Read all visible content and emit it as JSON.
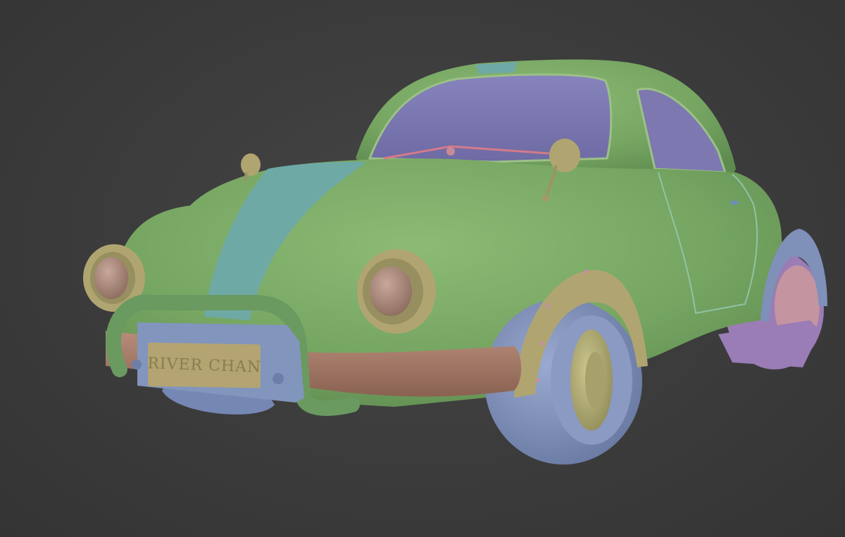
{
  "scene": {
    "subject": "stylized-car-model",
    "plate_text": "RIVER CHAN"
  },
  "colors": {
    "background": "#3b3b3b",
    "body_green": "#7ba866",
    "body_green_dark": "#5d8a4f",
    "stripe_teal": "#6ea9a6",
    "glass_purple": "#7d7ab3",
    "tire_blue": "#7f90b9",
    "rim_olive": "#b2ad77",
    "bumper_brown": "#a87a68",
    "plate_blue": "#8195bd",
    "plate_gold": "#b3a472",
    "light_olive": "#b0a571"
  }
}
